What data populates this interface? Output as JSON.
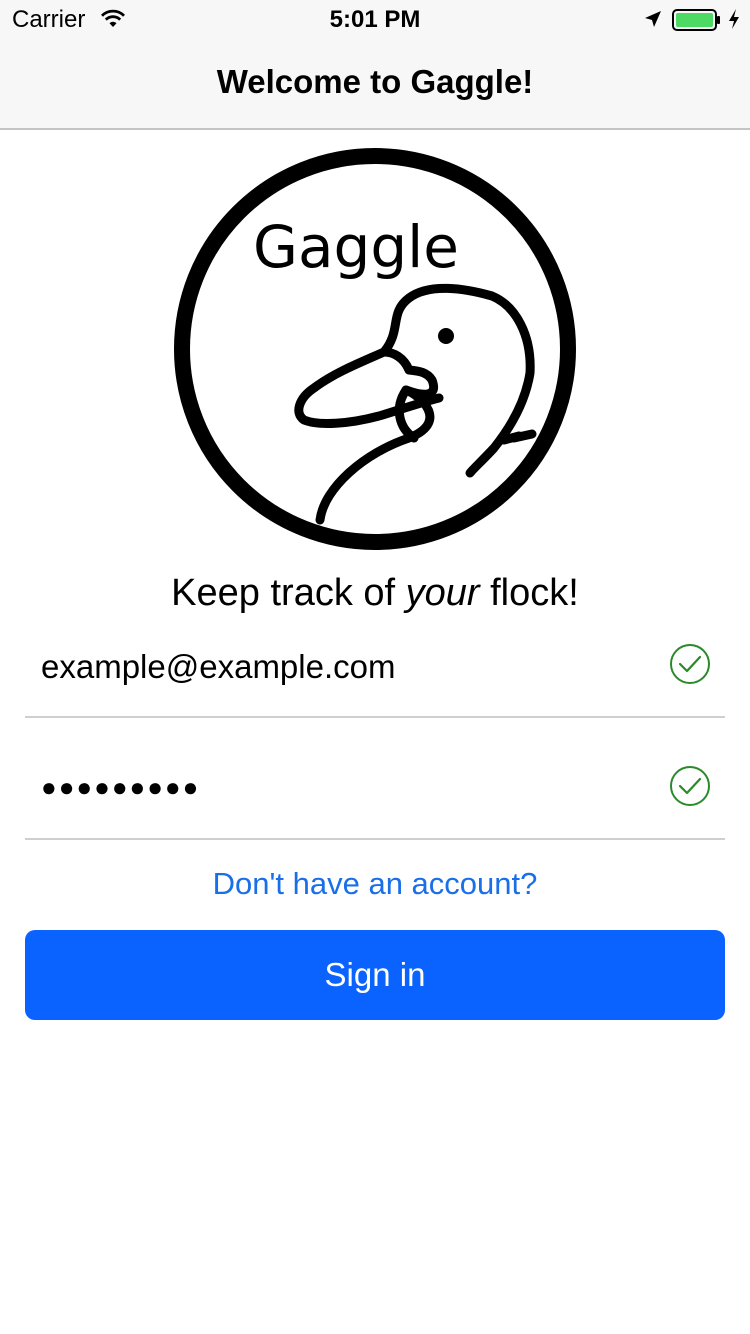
{
  "status_bar": {
    "carrier": "Carrier",
    "time": "5:01 PM",
    "battery_color": "#4cd964"
  },
  "nav": {
    "title": "Welcome to Gaggle!"
  },
  "logo": {
    "brand_text": "Gaggle",
    "icon": "duck-logo"
  },
  "tagline": {
    "before": "Keep track of ",
    "emphasis": "your",
    "after": " flock!"
  },
  "form": {
    "email": {
      "value": "example@example.com",
      "valid": true
    },
    "password": {
      "masked_value": "●●●●●●●●●",
      "valid": true
    },
    "check_color": "#2a8a2a"
  },
  "links": {
    "signup": "Don't have an account?"
  },
  "buttons": {
    "signin": "Sign in",
    "signin_color": "#0a62ff"
  }
}
